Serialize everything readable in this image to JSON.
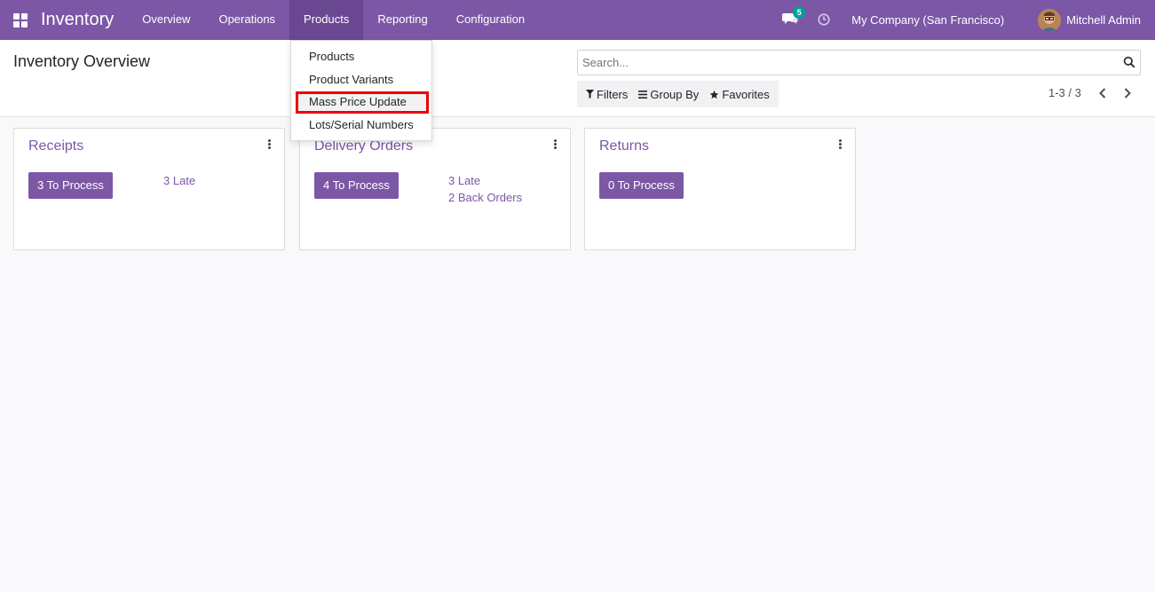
{
  "navbar": {
    "brand": "Inventory",
    "menu": [
      "Overview",
      "Operations",
      "Products",
      "Reporting",
      "Configuration"
    ],
    "active_menu": "Products",
    "chat_count": "5",
    "company": "My Company (San Francisco)",
    "user": "Mitchell Admin",
    "accent_color": "#7c57a6"
  },
  "control_panel": {
    "title": "Inventory Overview",
    "search_placeholder": "Search...",
    "filters_label": "Filters",
    "groupby_label": "Group By",
    "favorites_label": "Favorites",
    "pager": "1-3 / 3"
  },
  "products_dropdown": {
    "items": [
      "Products",
      "Product Variants",
      "Mass Price Update",
      "Lots/Serial Numbers"
    ],
    "highlighted": "Mass Price Update"
  },
  "cards": [
    {
      "title": "Receipts",
      "button": "3 To Process",
      "links": [
        "3 Late"
      ]
    },
    {
      "title": "Delivery Orders",
      "button": "4 To Process",
      "links": [
        "3 Late",
        "2 Back Orders"
      ]
    },
    {
      "title": "Returns",
      "button": "0 To Process",
      "links": []
    }
  ]
}
